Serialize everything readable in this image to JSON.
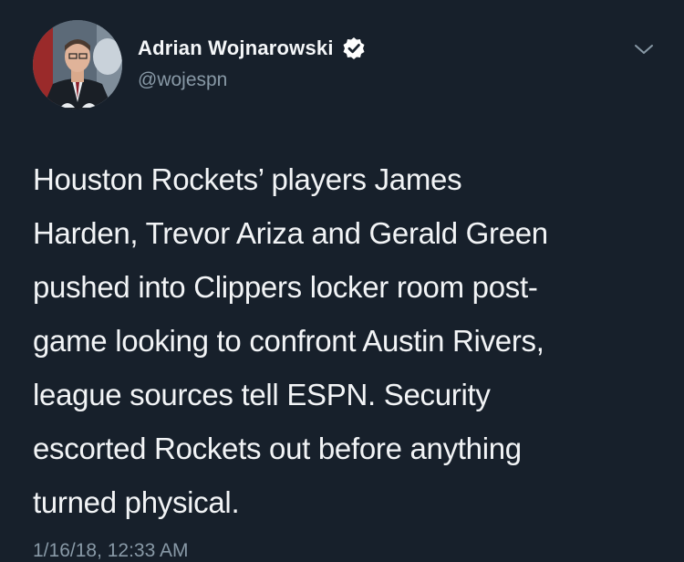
{
  "tweet": {
    "author_name": "Adrian Wojnarowski",
    "handle": "@wojespn",
    "verified_icon": "verified-badge-icon",
    "menu_icon": "chevron-down-icon",
    "text": "Houston Rockets’ players James\nHarden, Trevor Ariza and Gerald Green\npushed into Clippers locker room post-\ngame looking to confront Austin Rivers,\nleague sources tell ESPN. Security\nescorted Rockets out before anything\nturned physical.",
    "timestamp": "1/16/18, 12:33 AM"
  },
  "colors": {
    "background": "#17202b",
    "text": "#f2f4f6",
    "secondary_text": "#8899a6"
  }
}
